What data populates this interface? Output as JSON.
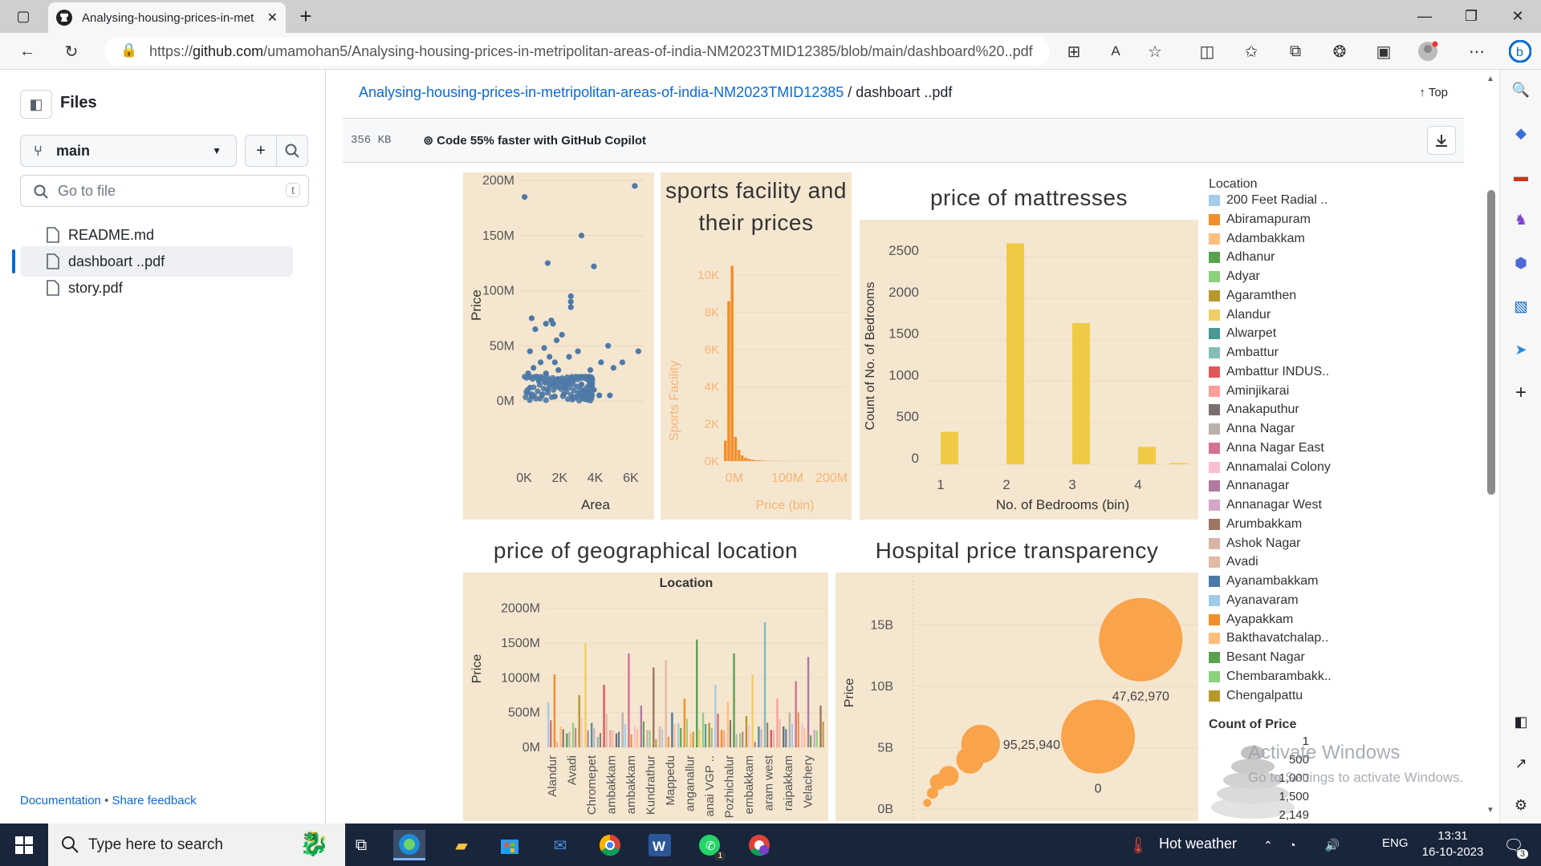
{
  "browser": {
    "tab_title": "Analysing-housing-prices-in-met",
    "url_prefix": "https://",
    "url_host": "github.com",
    "url_path": "/umamohan5/Analysing-housing-prices-in-metripolitan-areas-of-india-NM2023TMID12385/blob/main/dashboard%20..pdf"
  },
  "sidebar": {
    "title": "Files",
    "branch": "main",
    "search_placeholder": "Go to file",
    "search_shortcut": "t",
    "files": [
      {
        "name": "README.md"
      },
      {
        "name": "dashboart ..pdf"
      },
      {
        "name": "story.pdf"
      }
    ],
    "footer_docs": "Documentation",
    "footer_sep": " • ",
    "footer_feedback": "Share feedback"
  },
  "main": {
    "repo_link": "Analysing-housing-prices-in-metripolitan-areas-of-india-NM2023TMID12385",
    "crumb_sep": " / ",
    "file_name": "dashboart ..pdf",
    "top_label": "Top",
    "file_size": "356 KB",
    "copilot_text": "Code 55% faster with GitHub Copilot"
  },
  "chart_data": [
    {
      "type": "scatter",
      "title": "",
      "xlabel": "Area",
      "ylabel": "Price",
      "xticks": [
        "0K",
        "2K",
        "4K",
        "6K"
      ],
      "yticks": [
        "0M",
        "50M",
        "100M",
        "150M",
        "200M"
      ],
      "xlim": [
        0,
        7000
      ],
      "ylim": [
        0,
        200
      ],
      "points": [
        [
          300,
          185
        ],
        [
          3500,
          150
        ],
        [
          1600,
          125
        ],
        [
          6500,
          195
        ],
        [
          4200,
          122
        ],
        [
          2900,
          95
        ],
        [
          2900,
          90
        ],
        [
          2900,
          85
        ],
        [
          700,
          75
        ],
        [
          1500,
          70
        ],
        [
          1900,
          70
        ],
        [
          1800,
          73
        ],
        [
          5000,
          50
        ],
        [
          6700,
          45
        ],
        [
          5800,
          35
        ],
        [
          4600,
          35
        ],
        [
          5300,
          30
        ],
        [
          4000,
          28
        ],
        [
          3300,
          45
        ],
        [
          2400,
          60
        ],
        [
          2100,
          55
        ],
        [
          2800,
          40
        ],
        [
          1700,
          40
        ],
        [
          900,
          65
        ],
        [
          600,
          45
        ],
        [
          1200,
          35
        ],
        [
          1500,
          25
        ],
        [
          800,
          30
        ],
        [
          2200,
          28
        ],
        [
          3000,
          20
        ],
        [
          3500,
          15
        ],
        [
          4200,
          10
        ],
        [
          5100,
          5
        ],
        [
          4500,
          5
        ],
        [
          3800,
          8
        ],
        [
          2600,
          12
        ],
        [
          1900,
          15
        ],
        [
          1100,
          18
        ],
        [
          600,
          12
        ],
        [
          400,
          8
        ],
        [
          700,
          4
        ],
        [
          1300,
          6
        ],
        [
          2000,
          4
        ],
        [
          2500,
          6
        ],
        [
          3000,
          3
        ],
        [
          1600,
          10
        ],
        [
          1000,
          22
        ],
        [
          500,
          25
        ],
        [
          1400,
          48
        ],
        [
          2000,
          35
        ]
      ]
    },
    {
      "type": "bar",
      "title": "sports facility and their  prices",
      "xlabel": "Price (bin)",
      "ylabel": "Sports Facility",
      "xticks": [
        "0M",
        "100M",
        "200M"
      ],
      "yticks": [
        "0K",
        "2K",
        "4K",
        "6K",
        "8K",
        "10K"
      ],
      "ylim": [
        0,
        11000
      ],
      "values": [
        1100,
        8600,
        10500,
        1300,
        600,
        300,
        180,
        120,
        80,
        50,
        40,
        30,
        20,
        15,
        10,
        8,
        6,
        5,
        4,
        3
      ]
    },
    {
      "type": "bar",
      "title": "price of mattresses",
      "xlabel": "No. of Bedrooms (bin)",
      "ylabel": "Count of No. of Bedrooms",
      "categories": [
        "1",
        "2",
        "3",
        "4"
      ],
      "yticks": [
        "0",
        "500",
        "1000",
        "1500",
        "2000",
        "2500"
      ],
      "ylim": [
        0,
        2800
      ],
      "values": [
        390,
        2660,
        1700,
        210,
        15
      ]
    },
    {
      "type": "bar",
      "title": "price of geographical location",
      "column_header": "Location",
      "ylabel": "Price",
      "yticks": [
        "0M",
        "500M",
        "1000M",
        "1500M",
        "2000M"
      ],
      "ylim": [
        0,
        2100
      ],
      "tick_labels": [
        "Alandur",
        "Avadi",
        "Chromepet",
        "ambakkam",
        "ambakkam",
        "Kundrathur",
        "Mappedu",
        "anganallur",
        "anai VGP ..",
        "Pozhichalur",
        "embakkam",
        "aram west",
        "raipakkam",
        "Velachery"
      ],
      "values": [
        650,
        1050,
        300,
        200,
        350,
        750,
        1500,
        350,
        150,
        900,
        250,
        200,
        500,
        1350,
        300,
        600,
        250,
        1150,
        300,
        1250,
        500,
        350,
        700,
        200,
        1550,
        500,
        350,
        900,
        250,
        650,
        1350,
        200,
        450,
        1050,
        300,
        1800,
        250,
        700,
        300,
        500,
        950,
        350,
        1300,
        250,
        600
      ]
    },
    {
      "type": "scatter",
      "title": "Hospital price transparency",
      "ylabel": "Price",
      "yticks": [
        "0B",
        "5B",
        "10B",
        "15B"
      ],
      "ylim": [
        0,
        16
      ],
      "bubbles": [
        {
          "x": 1,
          "y": 0.5,
          "size": 10,
          "label": ""
        },
        {
          "x": 1.5,
          "y": 1.3,
          "size": 14,
          "label": ""
        },
        {
          "x": 2,
          "y": 2.2,
          "size": 20,
          "label": ""
        },
        {
          "x": 3,
          "y": 2.7,
          "size": 25,
          "label": ""
        },
        {
          "x": 5,
          "y": 4.0,
          "size": 34,
          "label": ""
        },
        {
          "x": 6,
          "y": 5.3,
          "size": 48,
          "label": "95,25,940"
        },
        {
          "x": 17,
          "y": 5.9,
          "size": 92,
          "label": "0"
        },
        {
          "x": 21,
          "y": 13.8,
          "size": 104,
          "label": "47,62,970"
        }
      ]
    }
  ],
  "legend": {
    "title": "Location",
    "items": [
      {
        "label": "200 Feet Radial ..",
        "color": "#a6cbe8"
      },
      {
        "label": "Abiramapuram",
        "color": "#f28e2b"
      },
      {
        "label": "Adambakkam",
        "color": "#ffbe7d"
      },
      {
        "label": "Adhanur",
        "color": "#59a14f"
      },
      {
        "label": "Adyar",
        "color": "#8cd17d"
      },
      {
        "label": "Agaramthen",
        "color": "#b6992d"
      },
      {
        "label": "Alandur",
        "color": "#f1ce63"
      },
      {
        "label": "Alwarpet",
        "color": "#499894"
      },
      {
        "label": "Ambattur",
        "color": "#86bcb6"
      },
      {
        "label": "Ambattur INDUS..",
        "color": "#e15759"
      },
      {
        "label": "Aminjikarai",
        "color": "#ff9d9a"
      },
      {
        "label": "Anakaputhur",
        "color": "#79706e"
      },
      {
        "label": "Anna Nagar",
        "color": "#bab0ac"
      },
      {
        "label": "Anna Nagar East",
        "color": "#d37295"
      },
      {
        "label": "Annamalai Colony",
        "color": "#fabfd2"
      },
      {
        "label": "Annanagar",
        "color": "#b07aa1"
      },
      {
        "label": "Annanagar West",
        "color": "#d4a6c8"
      },
      {
        "label": "Arumbakkam",
        "color": "#9d7660"
      },
      {
        "label": "Ashok Nagar",
        "color": "#d7b5a6"
      },
      {
        "label": "Avadi",
        "color": "#e4b9a6"
      },
      {
        "label": "Ayanambakkam",
        "color": "#4e79a7"
      },
      {
        "label": "Ayanavaram",
        "color": "#a0cbe8"
      },
      {
        "label": "Ayapakkam",
        "color": "#f28e2b"
      },
      {
        "label": "Bakthavatchalap..",
        "color": "#ffbe7d"
      },
      {
        "label": "Besant Nagar",
        "color": "#59a14f"
      },
      {
        "label": "Chembarambakk..",
        "color": "#8cd17d"
      },
      {
        "label": "Chengalpattu",
        "color": "#b6992d"
      }
    ],
    "size_title": "Count of Price",
    "size_items": [
      "1",
      "500",
      "1,000",
      "1,500",
      "2,149"
    ]
  },
  "watermark": {
    "line1": "Activate Windows",
    "line2": "Go to Settings to activate Windows."
  },
  "taskbar": {
    "search_placeholder": "Type here to search",
    "weather": "Hot weather",
    "lang": "ENG",
    "time": "13:31",
    "date": "16-10-2023",
    "notif_count": "3",
    "whatsapp_badge": "1"
  },
  "colors": {
    "scatter_blue": "#4e79a7",
    "orange": "#f28e2b",
    "bubble": "#f9a34a",
    "yellow": "#efcb45",
    "panel_bg": "#f5e6cf",
    "link": "#0969da"
  }
}
